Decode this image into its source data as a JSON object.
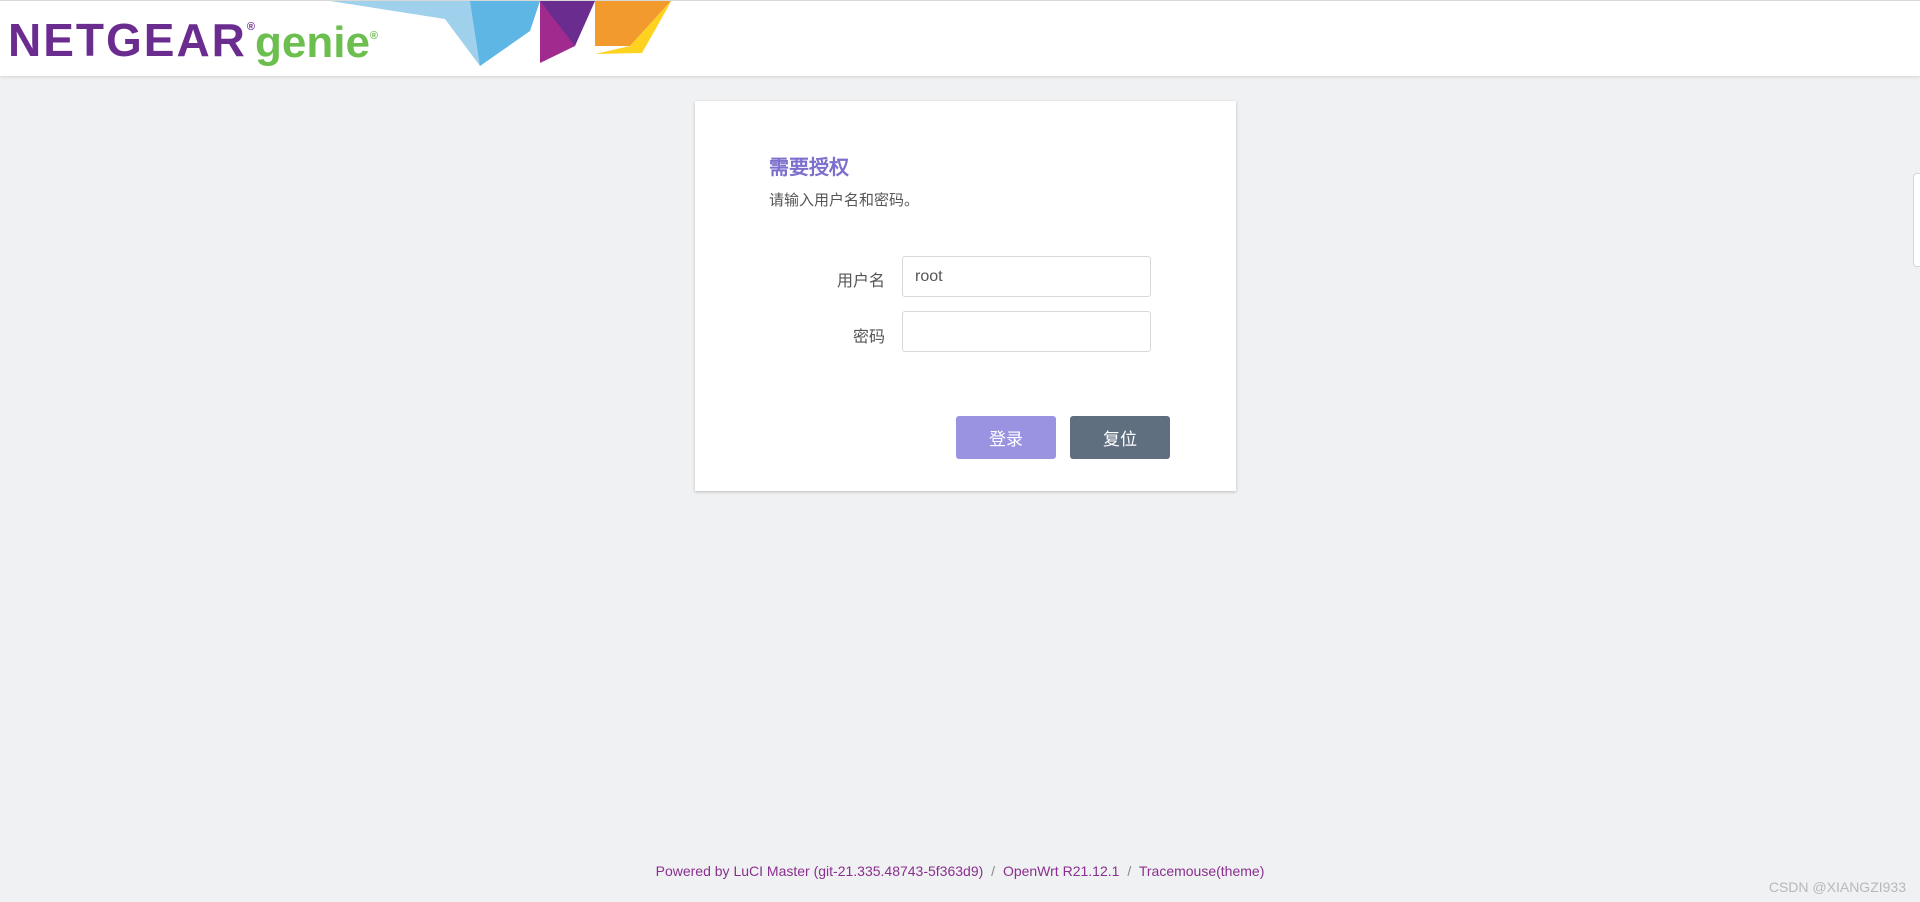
{
  "header": {
    "brand_text": "NETGEAR",
    "brand_mark": "®",
    "product_text": "genie",
    "product_mark": "®",
    "colors": {
      "brand": "#6a2c8e",
      "product": "#6cbf4f"
    }
  },
  "login": {
    "title": "需要授权",
    "description": "请输入用户名和密码。",
    "username_label": "用户名",
    "username_value": "root",
    "password_label": "密码",
    "password_value": "",
    "login_button": "登录",
    "reset_button": "复位",
    "colors": {
      "title": "#7c6fcd",
      "login_button": "#9a93e2",
      "reset_button": "#5f6f80"
    }
  },
  "footer": {
    "luci_link": "Powered by LuCI Master (git-21.335.48743-5f363d9)",
    "separator": "/",
    "openwrt_link": "OpenWrt R21.12.1",
    "theme_link": "Tracemouse(theme)",
    "link_color": "#8a2f8f"
  },
  "watermark": "CSDN @XIANGZI933"
}
